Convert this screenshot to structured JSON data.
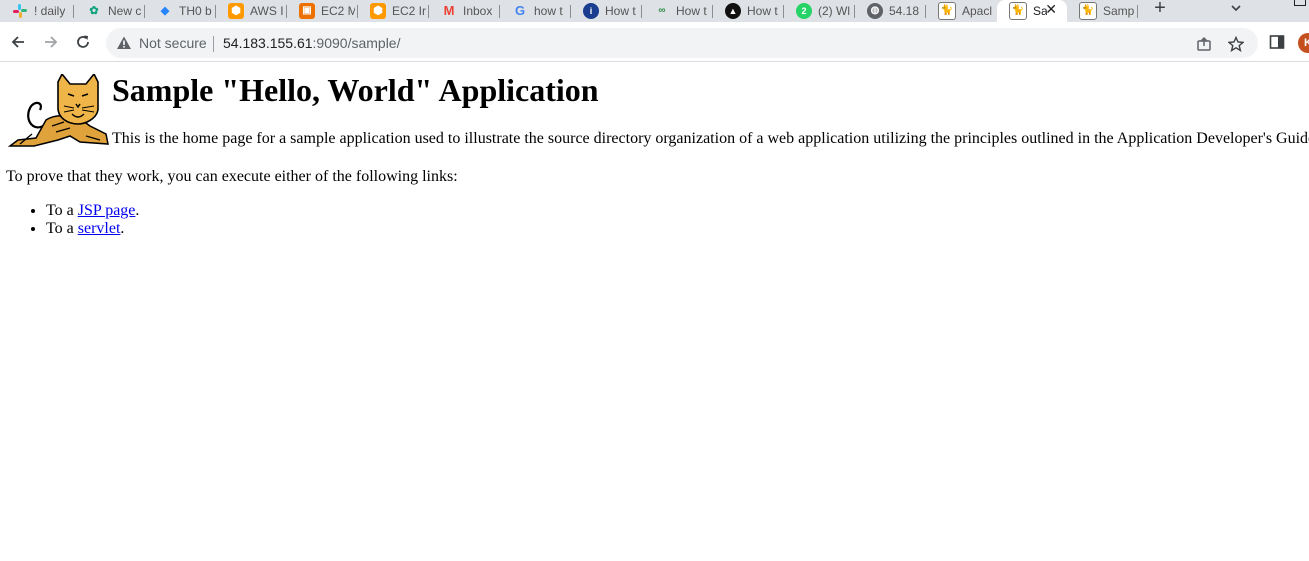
{
  "tabs": [
    {
      "label": "! daily",
      "icon": "slack-icon",
      "active": false
    },
    {
      "label": "New c",
      "icon": "openai-icon",
      "active": false
    },
    {
      "label": "TH0 b",
      "icon": "jira-icon",
      "active": false
    },
    {
      "label": "AWS I",
      "icon": "aws-icon",
      "active": false
    },
    {
      "label": "EC2 M",
      "icon": "ec2-icon",
      "active": false
    },
    {
      "label": "EC2 Ir",
      "icon": "aws-icon",
      "active": false
    },
    {
      "label": "Inbox",
      "icon": "gmail-icon",
      "active": false
    },
    {
      "label": "how t",
      "icon": "google-icon",
      "active": false
    },
    {
      "label": "How t",
      "icon": "info-icon",
      "active": false
    },
    {
      "label": "How t",
      "icon": "geeksforgeeks-icon",
      "active": false
    },
    {
      "label": "How t",
      "icon": "site-icon",
      "active": false
    },
    {
      "label": "(2) Wl",
      "icon": "whatsapp-icon",
      "active": false
    },
    {
      "label": "54.18",
      "icon": "globe-icon",
      "active": false
    },
    {
      "label": "Apacl",
      "icon": "tomcat-icon",
      "active": false
    },
    {
      "label": "Sa",
      "icon": "tomcat-icon",
      "active": true
    },
    {
      "label": "Samp",
      "icon": "tomcat-icon",
      "active": false
    }
  ],
  "toolbar": {
    "security_label": "Not secure",
    "url_host": "54.183.155.61",
    "url_path": ":9090/sample/",
    "profile_initial": "K"
  },
  "page": {
    "title": "Sample \"Hello, World\" Application",
    "intro": "This is the home page for a sample application used to illustrate the source directory organization of a web application utilizing the principles outlined in the Application Developer's Guide.",
    "prove": "To prove that they work, you can execute either of the following links:",
    "links": [
      {
        "prefix": "To a ",
        "link": "JSP page",
        "suffix": "."
      },
      {
        "prefix": "To a ",
        "link": "servlet",
        "suffix": "."
      }
    ]
  }
}
